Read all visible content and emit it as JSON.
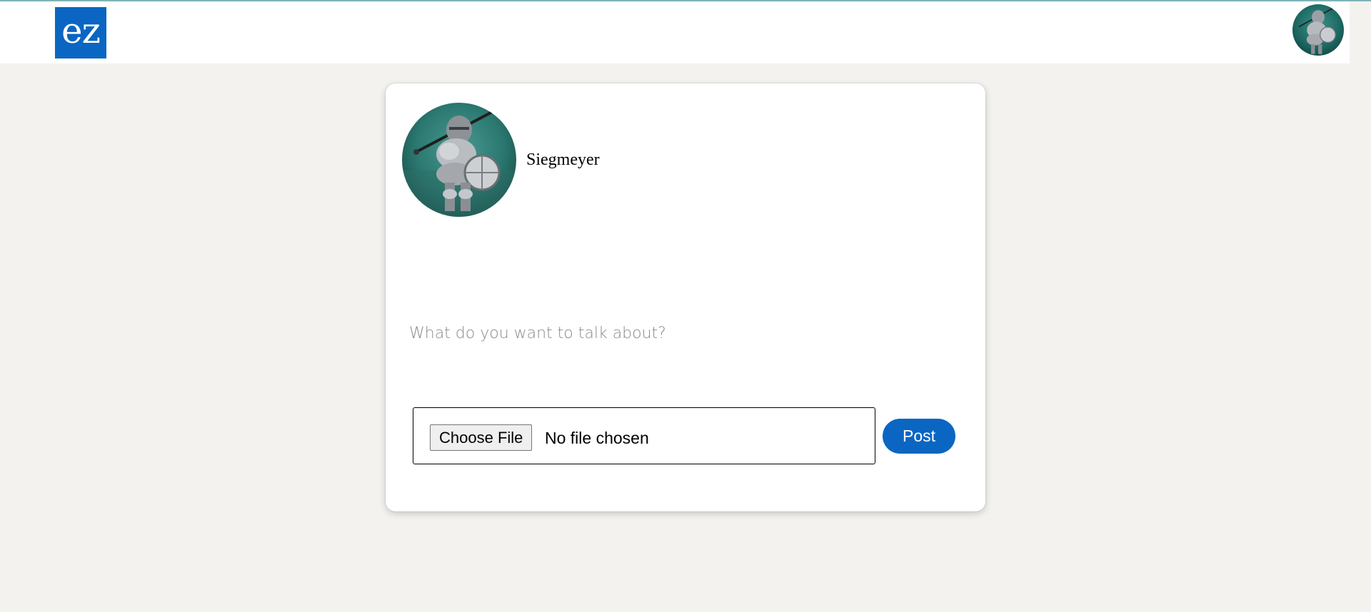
{
  "navbar": {
    "logo_text": "ez",
    "profile_avatar_icon": "knight-avatar"
  },
  "composer": {
    "username": "Siegmeyer",
    "avatar_icon": "knight-avatar",
    "post_placeholder": "What do you want to talk about?",
    "file_input": {
      "button_label": "Choose File",
      "status_text": "No file chosen"
    },
    "post_button_label": "Post"
  },
  "colors": {
    "brand": "#0a66c2",
    "page_background": "#f3f2ef"
  }
}
